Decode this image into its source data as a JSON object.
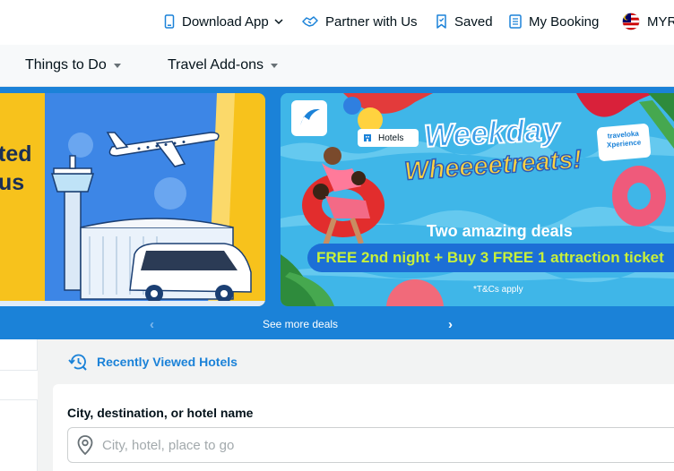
{
  "topbar": {
    "download_app": "Download App",
    "partner": "Partner with Us",
    "saved": "Saved",
    "my_booking": "My Booking",
    "currency": "MYR"
  },
  "nav": {
    "things_to_do": "Things to Do",
    "travel_addons": "Travel Add-ons"
  },
  "banner_left": {
    "text_line1": "ted",
    "text_line2": "us"
  },
  "banner_right": {
    "tag": "Hotels",
    "title1": "Weekday",
    "title2": "Wheeeetreats!",
    "brand": "traveloka Xperience",
    "subtitle": "Two amazing deals",
    "offer": "FREE 2nd night + Buy 3 FREE 1 attraction ticket",
    "tnc": "*T&Cs apply"
  },
  "deals": {
    "see_more": "See more deals",
    "prev": "‹",
    "next": "›"
  },
  "search": {
    "recent_label": "Recently Viewed Hotels",
    "field_label": "City, destination, or hotel name",
    "placeholder": "City, hotel, place to go"
  },
  "colors": {
    "brand_blue": "#1b82d8",
    "banner_yellow": "#f5c21b",
    "offer_green": "#c7f03b"
  }
}
